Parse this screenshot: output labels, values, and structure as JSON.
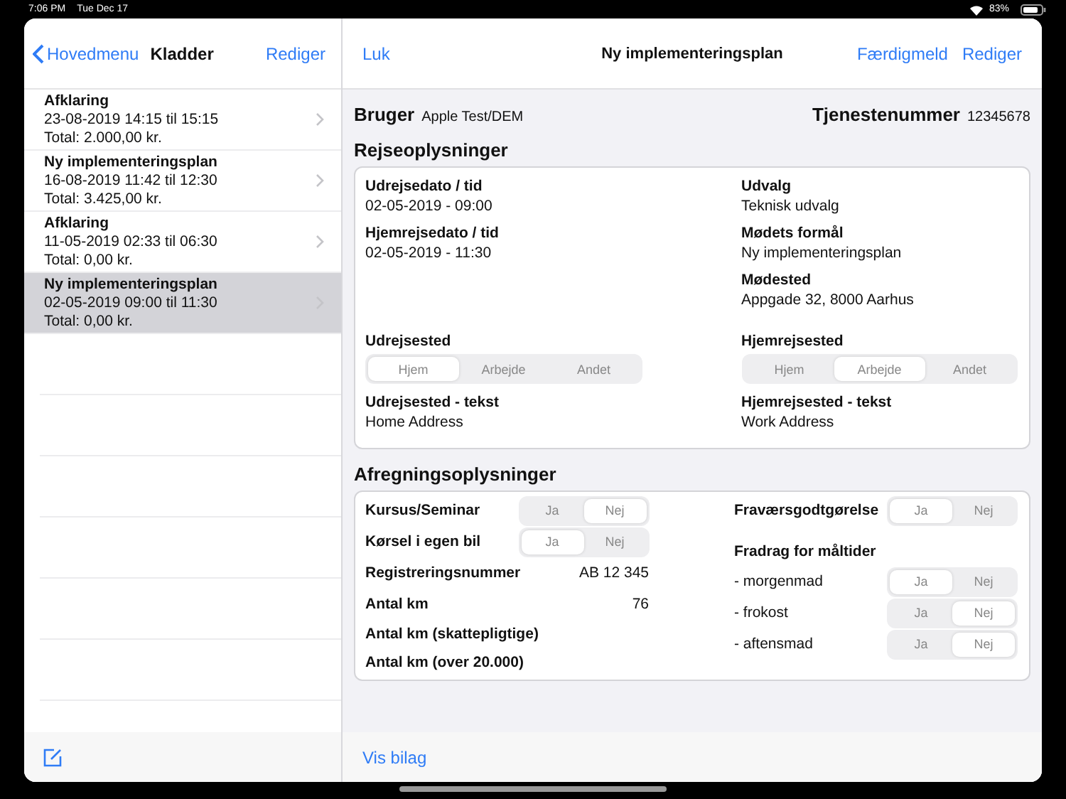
{
  "status_bar": {
    "time": "7:06 PM",
    "date": "Tue Dec 17",
    "battery": "83%"
  },
  "sidebar": {
    "back_label": "Hovedmenu",
    "title": "Kladder",
    "edit": "Rediger",
    "items": [
      {
        "title": "Afklaring",
        "dates": "23-08-2019 14:15  til  15:15",
        "total": "Total: 2.000,00 kr.",
        "selected": false
      },
      {
        "title": "Ny implementeringsplan",
        "dates": "16-08-2019 11:42  til  12:30",
        "total": "Total: 3.425,00 kr.",
        "selected": false
      },
      {
        "title": "Afklaring",
        "dates": "11-05-2019 02:33  til  06:30",
        "total": "Total: 0,00 kr.",
        "selected": false
      },
      {
        "title": "Ny implementeringsplan",
        "dates": "02-05-2019 09:00  til  11:30",
        "total": "Total: 0,00 kr.",
        "selected": true
      }
    ]
  },
  "detail": {
    "close": "Luk",
    "title": "Ny implementeringsplan",
    "actions": [
      "Færdigmeld",
      "Rediger"
    ],
    "user_label": "Bruger",
    "user_value": "Apple Test/DEM",
    "service_label": "Tjenestenummer",
    "service_value": "12345678",
    "travel": {
      "heading": "Rejseoplysninger",
      "rows": [
        [
          {
            "kind": "field",
            "label": "Udrejsedato / tid",
            "value": "02-05-2019 - 09:00"
          },
          {
            "kind": "field",
            "label": "Udvalg",
            "value": "Teknisk udvalg"
          }
        ],
        [
          {
            "kind": "field",
            "label": "Hjemrejsedato / tid",
            "value": "02-05-2019 - 11:30"
          },
          {
            "kind": "field",
            "label": "Mødets formål",
            "value": "Ny implementeringsplan"
          }
        ],
        [
          null,
          {
            "kind": "field",
            "label": "Mødested",
            "value": "Appgade 32, 8000 Aarhus"
          }
        ],
        [
          {
            "kind": "segment",
            "label": "Udrejsested",
            "options": [
              {
                "label": "Hjem",
                "selected": true
              },
              {
                "label": "Arbejde",
                "selected": false
              },
              {
                "label": "Andet",
                "selected": false
              }
            ]
          },
          {
            "kind": "segment",
            "label": "Hjemrejsested",
            "options": [
              {
                "label": "Hjem",
                "selected": false
              },
              {
                "label": "Arbejde",
                "selected": true
              },
              {
                "label": "Andet",
                "selected": false
              }
            ]
          }
        ],
        [
          {
            "kind": "field",
            "label": "Udrejsested - tekst",
            "value": "Home Address"
          },
          {
            "kind": "field",
            "label": "Hjemrejsested - tekst",
            "value": "Work Address"
          }
        ]
      ]
    },
    "settlement": {
      "heading": "Afregningsoplysninger",
      "left": [
        {
          "kind": "toggle",
          "label": "Kursus/Seminar",
          "options": [
            {
              "label": "Ja",
              "selected": false
            },
            {
              "label": "Nej",
              "selected": true
            }
          ]
        },
        {
          "kind": "toggle",
          "label": "Kørsel i egen bil",
          "options": [
            {
              "label": "Ja",
              "selected": true
            },
            {
              "label": "Nej",
              "selected": false
            }
          ]
        },
        {
          "kind": "value",
          "label": "Registreringsnummer",
          "value": "AB 12 345"
        },
        {
          "kind": "value",
          "label": "Antal km",
          "value": "76"
        },
        {
          "kind": "heading",
          "label": "Antal km (skattepligtige)"
        },
        {
          "kind": "heading",
          "label": "Antal km (over 20.000)"
        }
      ],
      "right": [
        {
          "kind": "toggle",
          "label": "Fraværsgodtgørelse",
          "options": [
            {
              "label": "Ja",
              "selected": true
            },
            {
              "label": "Nej",
              "selected": false
            }
          ]
        },
        {
          "kind": "heading",
          "label": "Fradrag for måltider"
        },
        {
          "kind": "subtoggle",
          "label": "- morgenmad",
          "options": [
            {
              "label": "Ja",
              "selected": true
            },
            {
              "label": "Nej",
              "selected": false
            }
          ]
        },
        {
          "kind": "subtoggle",
          "label": "- frokost",
          "options": [
            {
              "label": "Ja",
              "selected": false
            },
            {
              "label": "Nej",
              "selected": true
            }
          ]
        },
        {
          "kind": "subtoggle",
          "label": "- aftensmad",
          "options": [
            {
              "label": "Ja",
              "selected": false
            },
            {
              "label": "Nej",
              "selected": true
            }
          ]
        }
      ]
    },
    "bottom_link": "Vis bilag"
  }
}
